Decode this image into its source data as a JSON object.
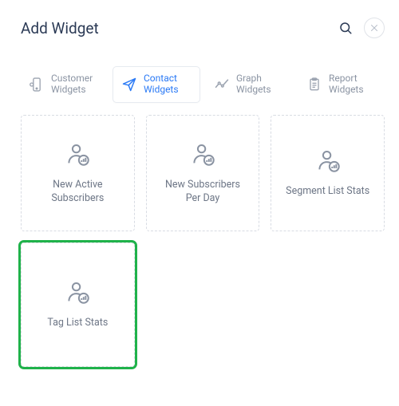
{
  "header": {
    "title": "Add Widget"
  },
  "tabs": [
    {
      "label": "Customer\nWidgets",
      "icon": "phone"
    },
    {
      "label": "Contact\nWidgets",
      "icon": "send",
      "active": true
    },
    {
      "label": "Graph\nWidgets",
      "icon": "trend"
    },
    {
      "label": "Report\nWidgets",
      "icon": "clipboard"
    }
  ],
  "cards": [
    {
      "label": "New Active\nSubscribers"
    },
    {
      "label": "New Subscribers\nPer Day"
    },
    {
      "label": "Segment List Stats"
    },
    {
      "label": "Tag List Stats",
      "highlight": true
    }
  ]
}
